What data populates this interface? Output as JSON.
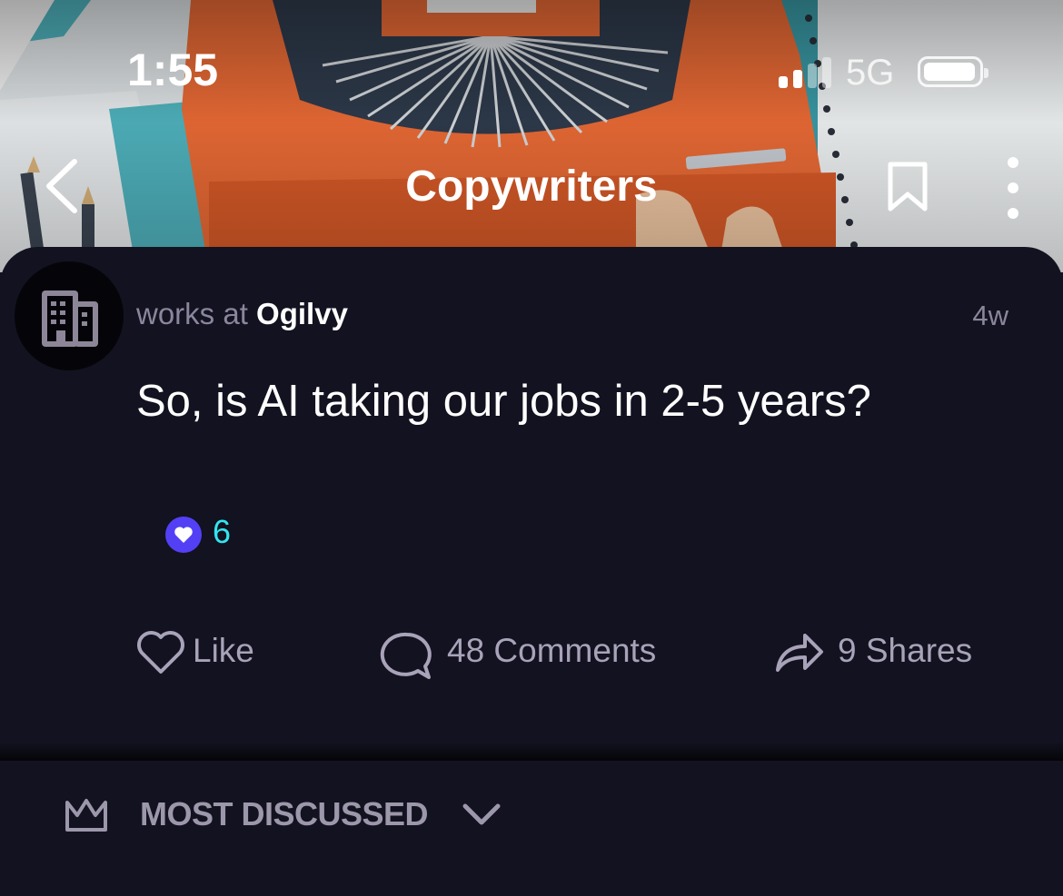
{
  "status_bar": {
    "time": "1:55",
    "network": "5G",
    "icons": [
      "signal-icon",
      "battery-icon"
    ]
  },
  "nav": {
    "title": "Copywriters",
    "icons": [
      "back-chevron-icon",
      "bookmark-icon",
      "more-vertical-icon"
    ]
  },
  "post": {
    "author_prefix": "works at ",
    "company": "Ogilvy",
    "timestamp": "4w",
    "title": "So, is AI taking our jobs in 2-5 years?",
    "reaction_count": "6",
    "avatar_icon": "building-icon",
    "reaction_icon": "heart-icon"
  },
  "actions": {
    "like": "Like",
    "comments": "48 Comments",
    "shares": "9 Shares"
  },
  "sort": {
    "label": "MOST DISCUSSED",
    "icon": "crown-icon"
  },
  "colors": {
    "background": "#121220",
    "reaction": "#5340f5",
    "reaction_count": "#32e6f0",
    "muted_text": "#a8a3b8"
  }
}
